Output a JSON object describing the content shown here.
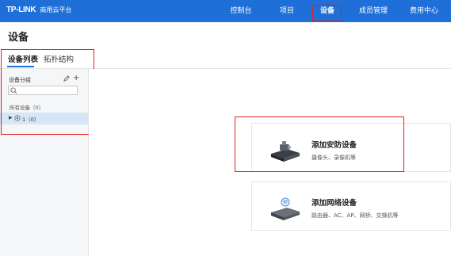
{
  "header": {
    "logo_text": "TP-LINK",
    "platform_name": "商用云平台",
    "nav": [
      {
        "label": "控制台",
        "active": false
      },
      {
        "label": "项目",
        "active": false
      },
      {
        "label": "设备",
        "active": true
      },
      {
        "label": "成员管理",
        "active": false
      },
      {
        "label": "费用中心",
        "active": false
      }
    ]
  },
  "page": {
    "title": "设备"
  },
  "tabs": [
    {
      "label": "设备列表",
      "active": true
    },
    {
      "label": "拓扑结构",
      "active": false
    }
  ],
  "sidebar": {
    "group_label": "设备分组",
    "search_placeholder": "",
    "all_devices_label": "所有设备（0）",
    "tree_items": [
      {
        "label": "1（0）",
        "selected": true
      }
    ]
  },
  "cards": [
    {
      "title": "添加安防设备",
      "description": "摄像头、录像机等",
      "icon": "security-camera-device-icon"
    },
    {
      "title": "添加网络设备",
      "description": "路由器、AC、AP、网桥、交换机等",
      "icon": "network-device-icon"
    }
  ],
  "colors": {
    "topbar": "#1e6fd8",
    "highlight_box": "#e02020",
    "selected_row": "#d6e6f8",
    "sidebar_bg": "#f5f6f7"
  }
}
